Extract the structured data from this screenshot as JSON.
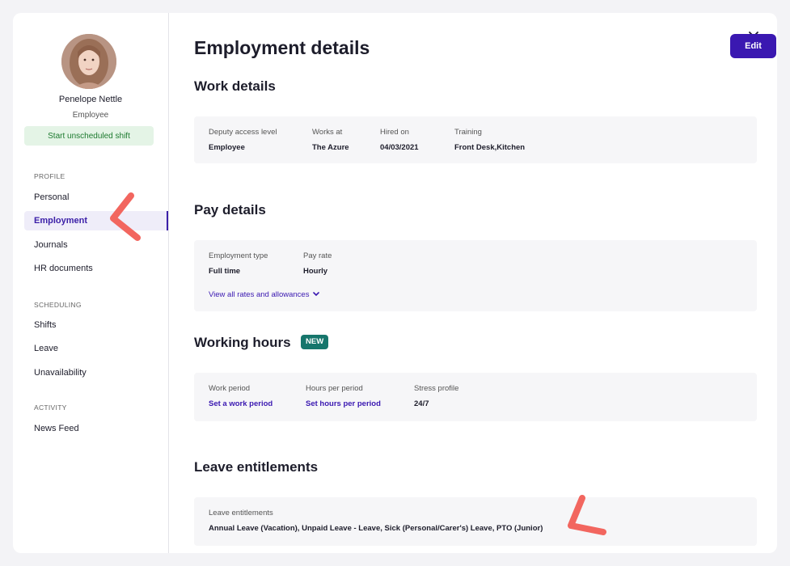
{
  "user": {
    "name": "Penelope Nettle",
    "role": "Employee"
  },
  "sidebar": {
    "start_shift_label": "Start unscheduled shift",
    "sections": {
      "profile": "PROFILE",
      "scheduling": "SCHEDULING",
      "activity": "ACTIVITY"
    },
    "items": {
      "personal": "Personal",
      "employment": "Employment",
      "journals": "Journals",
      "hr_documents": "HR documents",
      "shifts": "Shifts",
      "leave": "Leave",
      "unavailability": "Unavailability",
      "news_feed": "News Feed"
    }
  },
  "main": {
    "title": "Employment details",
    "edit_label": "Edit",
    "work_details": {
      "title": "Work details",
      "fields": [
        {
          "label": "Deputy access level",
          "value": "Employee"
        },
        {
          "label": "Works at",
          "value": "The Azure"
        },
        {
          "label": "Hired on",
          "value": "04/03/2021"
        },
        {
          "label": "Training",
          "value": "Front Desk,Kitchen"
        }
      ]
    },
    "pay_details": {
      "title": "Pay details",
      "fields": [
        {
          "label": "Employment type",
          "value": "Full time"
        },
        {
          "label": "Pay rate",
          "value": "Hourly"
        }
      ],
      "view_rates_label": "View all rates and allowances"
    },
    "working_hours": {
      "title": "Working hours",
      "badge": "NEW",
      "fields": [
        {
          "label": "Work period",
          "value": "Set a work period"
        },
        {
          "label": "Hours per period",
          "value": "Set hours per period"
        },
        {
          "label": "Stress profile",
          "value": "24/7"
        }
      ]
    },
    "leave_entitlements": {
      "title": "Leave entitlements",
      "label": "Leave entitlements",
      "value": "Annual Leave (Vacation), Unpaid Leave - Leave, Sick (Personal/Carer's) Leave, PTO (Junior)"
    }
  },
  "icons": {
    "close": "close-icon",
    "chevron": "chevron-down-icon",
    "avatar": "avatar"
  },
  "colors": {
    "accent": "#3a18b1",
    "badge": "#16766c",
    "annotation": "#f2665f",
    "start_shift_bg": "#e4f4e6"
  }
}
